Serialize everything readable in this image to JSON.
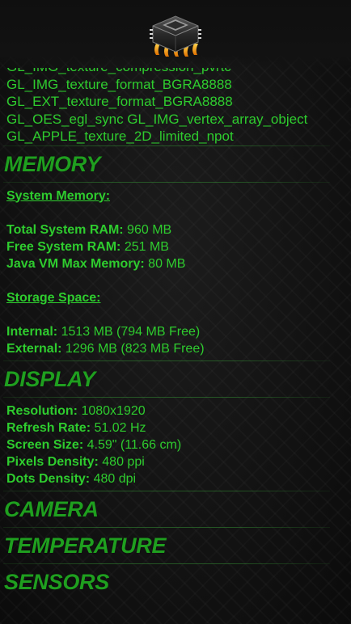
{
  "gl_extensions": [
    "GL_IMG_texture_compression_pvrtc",
    "GL_IMG_texture_format_BGRA8888",
    "GL_EXT_texture_format_BGRA8888",
    "GL_OES_egl_sync GL_IMG_vertex_array_object",
    "GL_APPLE_texture_2D_limited_npot"
  ],
  "memory": {
    "title": "MEMORY",
    "system_heading": "System Memory:",
    "total_label": "Total System RAM:",
    "total_value": " 960 MB",
    "free_label": "Free System RAM:",
    "free_value": " 251 MB",
    "java_label": "Java VM Max Memory:",
    "java_value": " 80 MB",
    "storage_heading": "Storage Space:",
    "internal_label": "Internal:",
    "internal_value": " 1513 MB (794 MB Free)",
    "external_label": "External:",
    "external_value": " 1296 MB (823 MB Free)"
  },
  "display": {
    "title": "DISPLAY",
    "resolution_label": "Resolution:",
    "resolution_value": " 1080x1920",
    "refresh_label": "Refresh Rate:",
    "refresh_value": " 51.02 Hz",
    "size_label": "Screen Size:",
    "size_value": " 4.59\" (11.66 cm)",
    "pixels_label": "Pixels Density:",
    "pixels_value": " 480 ppi",
    "dots_label": "Dots Density:",
    "dots_value": " 480 dpi"
  },
  "sections": {
    "camera": "CAMERA",
    "temperature": "TEMPERATURE",
    "sensors": "SENSORS"
  },
  "theme": {
    "accent": "#2ecc2e",
    "title_color": "#1f9f1f",
    "background": "#111111"
  },
  "icons": {
    "app_logo": "cpu-chip-icon"
  }
}
